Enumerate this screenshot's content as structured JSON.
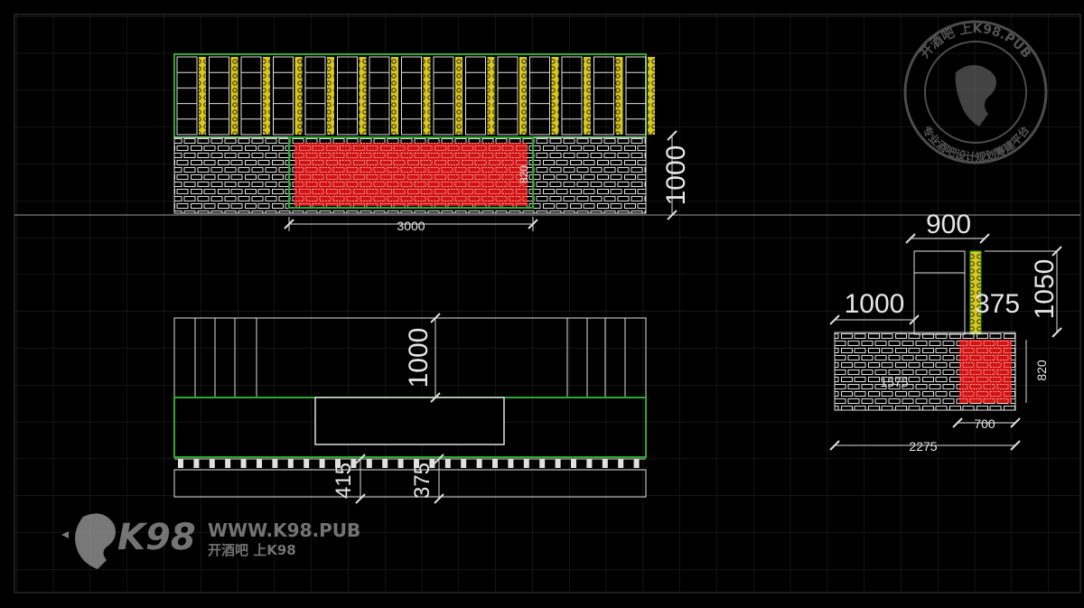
{
  "drawing": {
    "front_elevation": {
      "dim_width": "3000",
      "dim_height": "1000",
      "dim_panel_height": "820"
    },
    "plan_view": {
      "dim_depth": "1000",
      "dim_a": "415",
      "dim_b": "375"
    },
    "side_section": {
      "dim_top_width": "900",
      "dim_height_total": "1050",
      "dim_left": "1000",
      "dim_right": "375",
      "dim_panel_height": "820",
      "dim_inner": "1575",
      "dim_panel_width": "700",
      "dim_total_width": "2275"
    }
  },
  "colors": {
    "background": "#000000",
    "grid": "#2a2a2a",
    "lines": "#e8e8e8",
    "frame_green": "#2ea82e",
    "accent_yellow": "#e0d020",
    "panel_red": "#d81818"
  },
  "watermark": {
    "url": "WWW.K98.PUB",
    "tagline": "开酒吧 上K98",
    "brand": "K98",
    "stamp_top": "开酒吧 上K98.PUB",
    "stamp_bottom": "专业酒吧设计规划筹建平台"
  }
}
